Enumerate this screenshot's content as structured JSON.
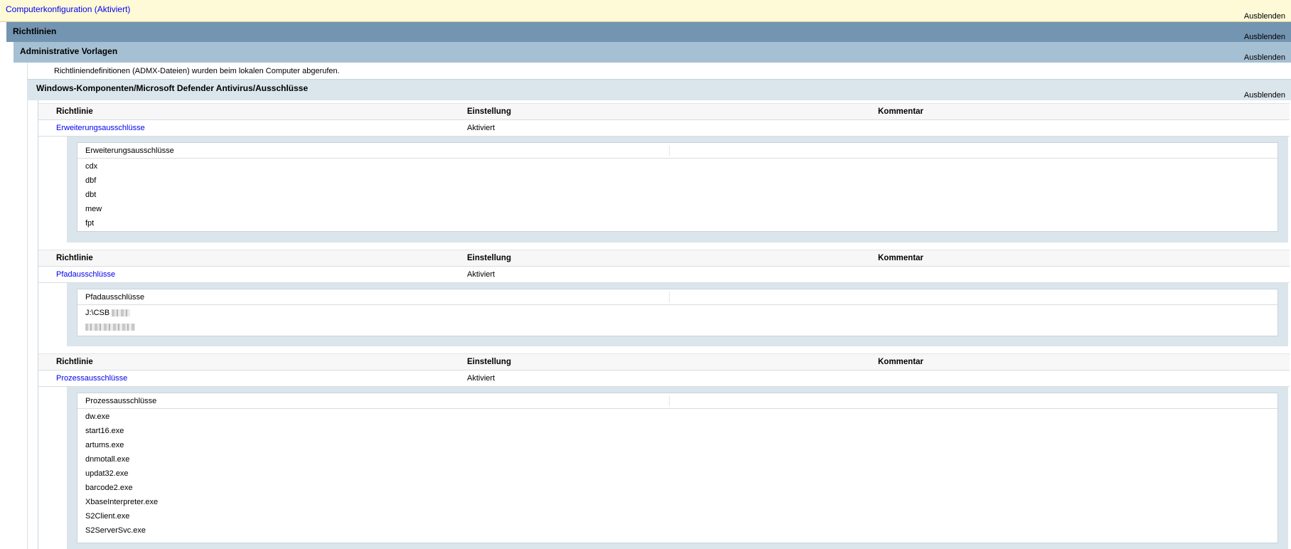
{
  "hide_label": "Ausblenden",
  "computer": {
    "title": "Computerkonfiguration (Aktiviert)"
  },
  "policies": {
    "title": "Richtlinien"
  },
  "admin": {
    "title": "Administrative Vorlagen",
    "note": "Richtliniendefinitionen (ADMX-Dateien) wurden beim lokalen Computer abgerufen."
  },
  "component": {
    "title": "Windows-Komponenten/Microsoft Defender Antivirus/Ausschlüsse"
  },
  "columns": {
    "policy": "Richtlinie",
    "setting": "Einstellung",
    "comment": "Kommentar"
  },
  "sections": [
    {
      "policy": "Erweiterungsausschlüsse",
      "setting": "Aktiviert",
      "list_title": "Erweiterungsausschlüsse",
      "items": [
        "cdx",
        "dbf",
        "dbt",
        "mew",
        "fpt"
      ]
    },
    {
      "policy": "Pfadausschlüsse",
      "setting": "Aktiviert",
      "list_title": "Pfadausschlüsse",
      "items": [
        "J:\\CSB",
        ""
      ]
    },
    {
      "policy": "Prozessausschlüsse",
      "setting": "Aktiviert",
      "list_title": "Prozessausschlüsse",
      "items": [
        "dw.exe",
        "start16.exe",
        "artums.exe",
        "dnmotall.exe",
        "updat32.exe",
        "barcode2.exe",
        "XbaseInterpreter.exe",
        "S2Client.exe",
        "S2ServerSvc.exe"
      ]
    }
  ]
}
